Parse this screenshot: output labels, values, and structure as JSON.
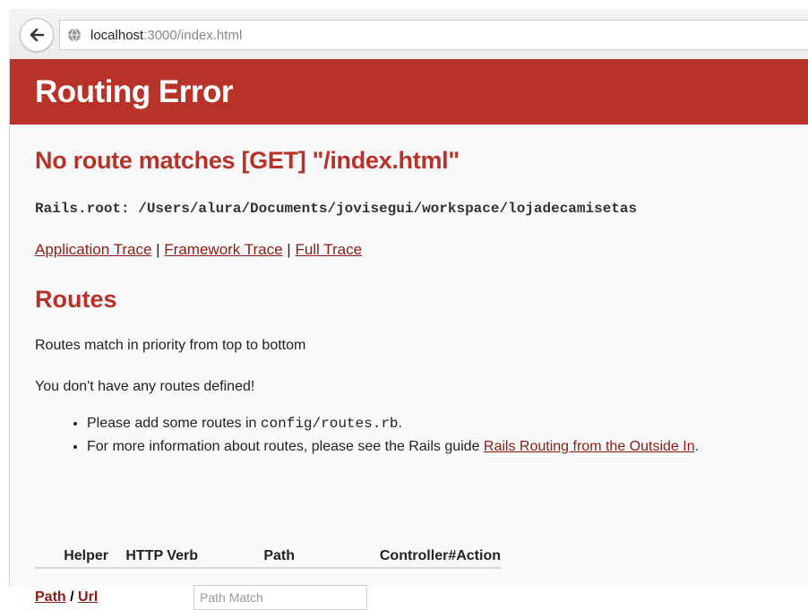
{
  "browser": {
    "url_host": "localhost",
    "url_path": ":3000/index.html"
  },
  "page": {
    "title": "Routing Error",
    "error_message": "No route matches [GET] \"/index.html\"",
    "rails_root": "Rails.root: /Users/alura/Documents/jovisegui/workspace/lojadecamisetas",
    "traces": {
      "application": "Application Trace",
      "framework": "Framework Trace",
      "full": "Full Trace",
      "separator": "|"
    },
    "routes_heading": "Routes",
    "priority_note": "Routes match in priority from top to bottom",
    "no_routes": "You don't have any routes defined!",
    "tip1_prefix": "Please add some routes in",
    "tip1_code": "config/routes.rb",
    "tip1_suffix": ".",
    "tip2_prefix": "For more information about routes, please see the Rails guide",
    "tip2_link": "Rails Routing from the Outside In",
    "tip2_suffix": ".",
    "table_headers": [
      "Helper",
      "HTTP Verb",
      "Path",
      "Controller#Action"
    ],
    "matcher": {
      "path_link": "Path",
      "separator": "/",
      "url_link": "Url",
      "input_placeholder": "Path Match"
    }
  },
  "colors": {
    "header_bg": "#b7332a",
    "heading": "#b7332a",
    "link": "#8c1c13",
    "page_bg": "#f9f9fb"
  }
}
